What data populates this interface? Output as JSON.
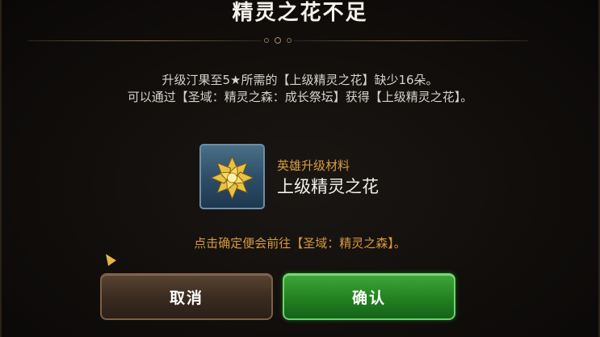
{
  "dialog": {
    "title": "精灵之花不足",
    "message_line1": "升级汀果至5★所需的【上级精灵之花】缺少16朵。",
    "message_line2": "可以通过【圣域：精灵之森：成长祭坛】获得【上级精灵之花】。",
    "item": {
      "category": "英雄升级材料",
      "name": "上级精灵之花",
      "icon": "golden-flower-icon"
    },
    "hint": "点击确定便会前往【圣域：精灵之森】。",
    "cancel_label": "取消",
    "confirm_label": "确认"
  },
  "colors": {
    "accent_orange": "#d89d3e",
    "confirm_green": "#23811f",
    "cancel_brown": "#3b2c21"
  }
}
